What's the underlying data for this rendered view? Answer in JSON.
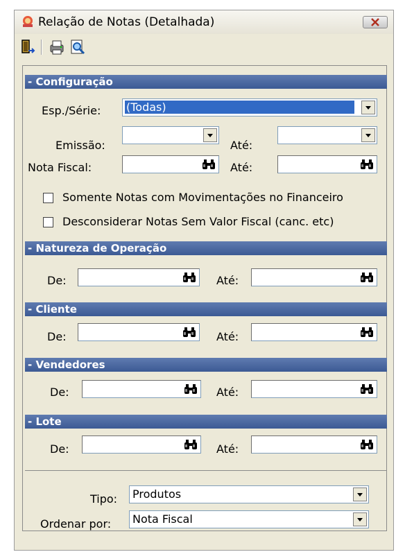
{
  "window": {
    "title": "Relação de Notas (Detalhada)"
  },
  "toolbar": {
    "buttons": [
      "exit-icon",
      "printer-icon",
      "preview-icon"
    ]
  },
  "configuracao": {
    "header": "- Configuração",
    "esp_serie_label": "Esp./Série:",
    "esp_serie_value": "(Todas)",
    "emissao_label": "Emissão:",
    "emissao_ate_label": "Até:",
    "nota_fiscal_label": "Nota Fiscal:",
    "nota_fiscal_ate_label": "Até:",
    "checkbox1_label": "Somente Notas com Movimentações no Financeiro",
    "checkbox2_label": "Desconsiderar Notas Sem Valor Fiscal (canc. etc)"
  },
  "natureza": {
    "header": "- Natureza de Operação",
    "de_label": "De:",
    "ate_label": "Até:"
  },
  "cliente": {
    "header": "- Cliente",
    "de_label": "De:",
    "ate_label": "Até:"
  },
  "vendedores": {
    "header": "- Vendedores",
    "de_label": "De:",
    "ate_label": "Até:"
  },
  "lote": {
    "header": "- Lote",
    "de_label": "De:",
    "ate_label": "Até:"
  },
  "bottom": {
    "tipo_label": "Tipo:",
    "tipo_value": "Produtos",
    "ordenar_label": "Ordenar por:",
    "ordenar_value": "Nota Fiscal"
  },
  "colors": {
    "section_header": "#3c5a94",
    "selection": "#316ac5",
    "background": "#ece9d8"
  }
}
